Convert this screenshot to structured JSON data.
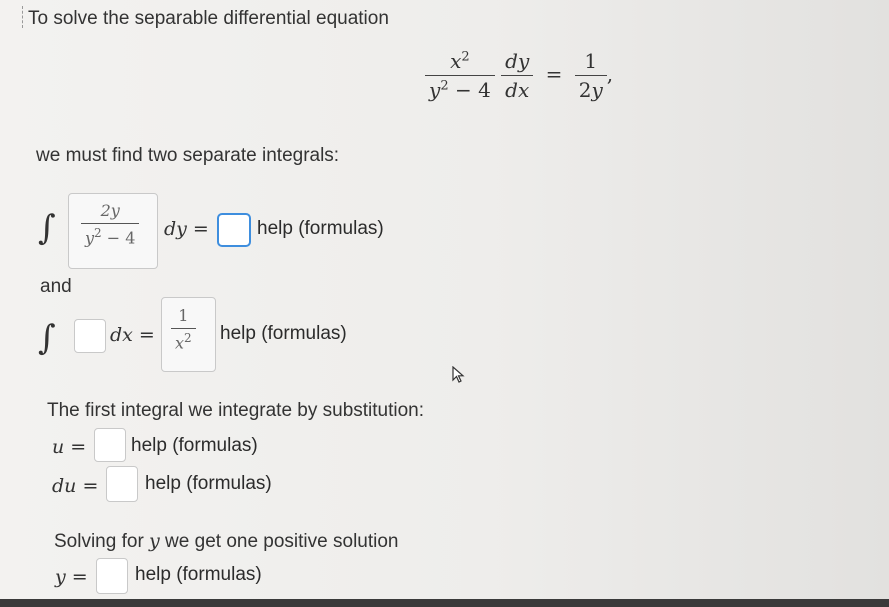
{
  "intro": "To solve the separable differential equation",
  "equation": {
    "lhs_num": "x",
    "lhs_num_exp": "2",
    "lhs_den_y": "y",
    "lhs_den_exp": "2",
    "lhs_den_rest": " − 4",
    "dy": "dy",
    "dx": "dx",
    "eq": "=",
    "rhs_num": "1",
    "rhs_den": "2y",
    "comma": ","
  },
  "must_find": "we must find two separate integrals:",
  "integral1": {
    "sign": "∫",
    "answer_num": "2y",
    "answer_den_y": "y",
    "answer_den_exp": "2",
    "answer_den_rest": " − 4",
    "dvar": "dy =",
    "help": "help (formulas)"
  },
  "and_label": "and",
  "integral2": {
    "sign": "∫",
    "dvar": "dx =",
    "answer_num": "1",
    "answer_den_x": "x",
    "answer_den_exp": "2",
    "help": "help (formulas)"
  },
  "substitution_text": "The first integral we integrate by substitution:",
  "u_row": {
    "label": "u =",
    "help": "help (formulas)"
  },
  "du_row": {
    "label": "du =",
    "help": "help (formulas)"
  },
  "solving_text_pre": "Solving for ",
  "solving_var": "y",
  "solving_text_post": " we get one positive solution",
  "y_row": {
    "label": "y =",
    "help": "help (formulas)"
  },
  "colors": {
    "focus_border": "#3e8ede",
    "box_border": "#c9c9c9"
  }
}
